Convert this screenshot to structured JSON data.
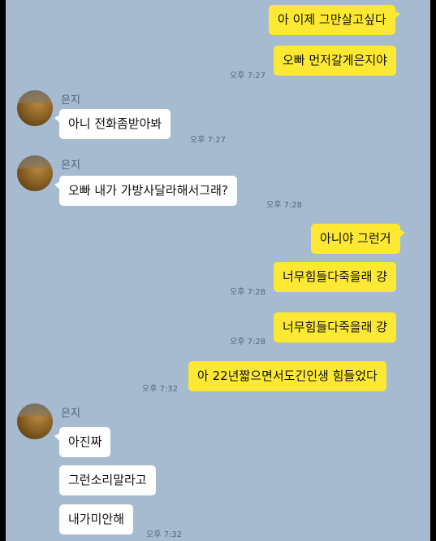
{
  "messages": [
    {
      "text": "아 이제 그만살고싶다"
    },
    {
      "text": "오빠 먼저갈게은지야",
      "time": "오후 7:27"
    },
    {
      "sender": "은지",
      "text": "아니 전화좀받아봐",
      "time": "오후 7:27"
    },
    {
      "sender": "은지",
      "text": "오빠 내가 가방사달라해서그래?",
      "time": "오후 7:28"
    },
    {
      "text": "아니야 그런거"
    },
    {
      "text": "너무힘들다죽을래 걍",
      "time": "오후 7:28"
    },
    {
      "text": "너무힘들다죽을래 걍",
      "time": "오후 7:28"
    },
    {
      "text": "아 22년짧으면서도긴인생 힘들었다",
      "time": "오후 7:32"
    },
    {
      "sender": "은지",
      "text": "아진짜"
    },
    {
      "text": "그런소리말라고"
    },
    {
      "text": "내가미안해",
      "time": "오후 7:32"
    }
  ]
}
